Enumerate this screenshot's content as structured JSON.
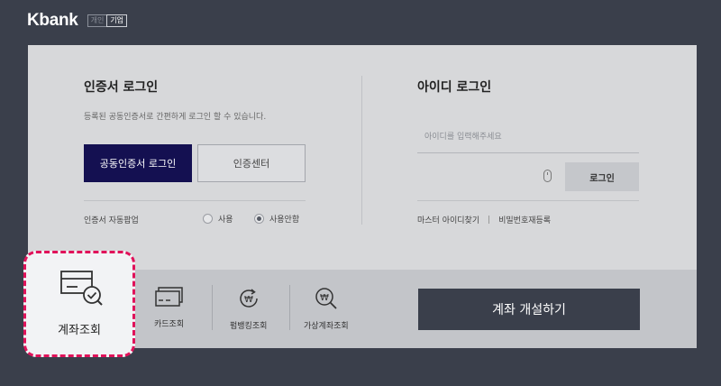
{
  "header": {
    "brand": "Kbank",
    "personal_tab": "개인",
    "business_tab": "기업"
  },
  "cert_login": {
    "title": "인증서 로그인",
    "description": "등록된 공동인증서로 간편하게 로그인 할 수 있습니다.",
    "cert_button": "공동인증서 로그인",
    "center_button": "인증센터",
    "popup_label": "인증서 자동팝업",
    "options": [
      "사용",
      "사용안함"
    ],
    "selected_option": "사용안함"
  },
  "id_login": {
    "title": "아이디 로그인",
    "id_placeholder": "아이디를 입력해주세요",
    "login_button": "로그인",
    "links": [
      "마스터 아이디찾기",
      "비밀번호재등록"
    ]
  },
  "quick_menu": {
    "items": [
      {
        "label": "계좌조회",
        "icon": "account-inquiry-icon"
      },
      {
        "label": "카드조회",
        "icon": "card-inquiry-icon"
      },
      {
        "label": "펌뱅킹조회",
        "icon": "firmbanking-inquiry-icon"
      },
      {
        "label": "가상계좌조회",
        "icon": "virtual-account-inquiry-icon"
      }
    ]
  },
  "open_account_button": "계좌 개설하기",
  "colors": {
    "background": "#3a3f4b",
    "primary_button": "#141051",
    "highlight": "#e0125a"
  }
}
